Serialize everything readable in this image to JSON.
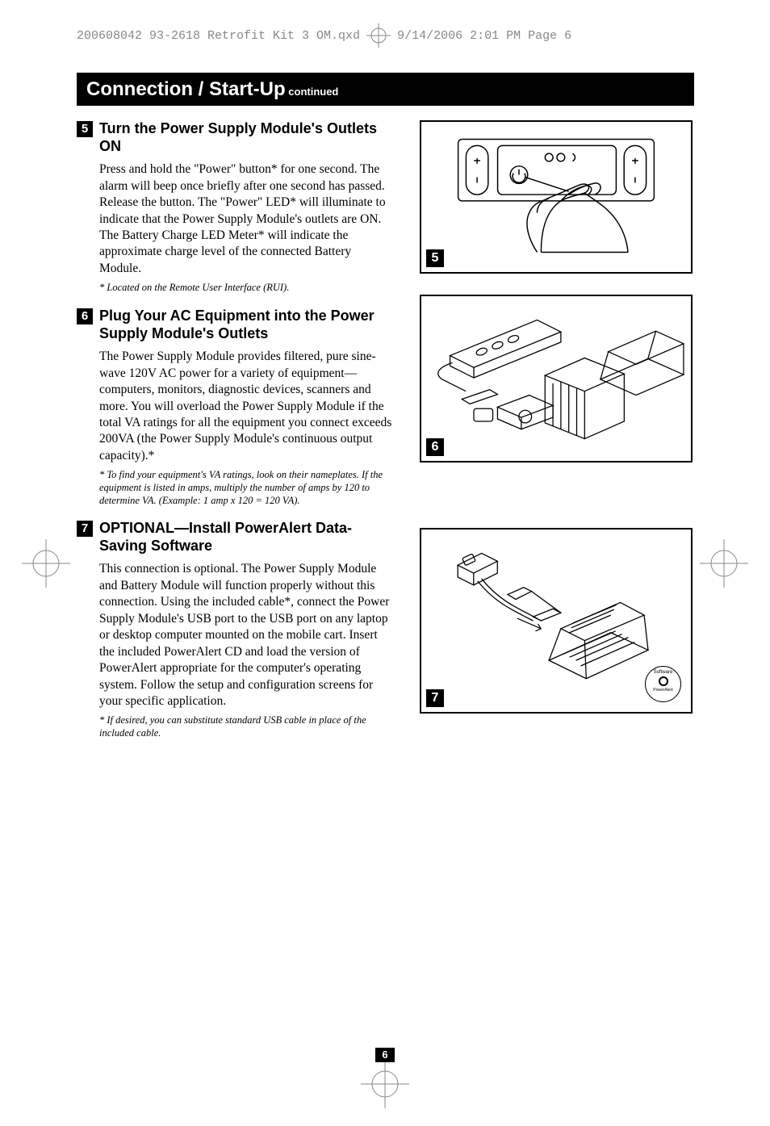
{
  "header": {
    "file_info_left": "200608042 93-2618 Retrofit Kit 3 OM.qxd",
    "file_info_right": "9/14/2006  2:01 PM  Page 6"
  },
  "section_bar": {
    "title": "Connection / Start-Up",
    "continued": " continued"
  },
  "steps": [
    {
      "number": "5",
      "title": "Turn the Power Supply Module's Outlets ON",
      "body": "Press and hold the \"Power\" button* for one second. The alarm will beep once briefly after one second has passed. Release the button. The \"Power\" LED* will illuminate to indicate that the Power Supply Module's outlets are ON. The Battery Charge LED Meter* will indicate the approximate charge level of the connected Battery Module.",
      "footnote": "* Located on the Remote User Interface (RUI)."
    },
    {
      "number": "6",
      "title": "Plug Your AC Equipment into the Power Supply Module's Outlets",
      "body": "The Power Supply Module provides filtered, pure sine-wave 120V AC power for a variety of equipment—computers, monitors, diagnostic devices, scanners and more. You will overload the Power Supply Module if the total VA ratings for all the equipment you connect exceeds 200VA (the Power Supply Module's continuous output capacity).*",
      "footnote": "* To find your equipment's VA ratings, look on their nameplates. If the equipment is listed in amps, multiply the number of amps by 120 to determine VA. (Example: 1 amp x 120 = 120 VA)."
    },
    {
      "number": "7",
      "title": "OPTIONAL—Install PowerAlert Data-Saving Software",
      "body": "This connection is optional. The Power Supply Module and Battery Module will function properly without this connection. Using the included cable*, connect the Power Supply Module's USB port to the USB port on any laptop or desktop computer mounted on the mobile cart. Insert the included PowerAlert CD and load the version of PowerAlert appropriate for the computer's operating system. Follow the setup and configuration screens for your specific application.",
      "footnote": "* If desired, you can substitute standard USB cable in place of the included cable."
    }
  ],
  "figures": {
    "fig1_num": "5",
    "fig2_num": "6",
    "fig3_num": "7",
    "fig3_label_top": "Software",
    "fig3_label_bottom": "PowerAlert"
  },
  "page_number": "6"
}
